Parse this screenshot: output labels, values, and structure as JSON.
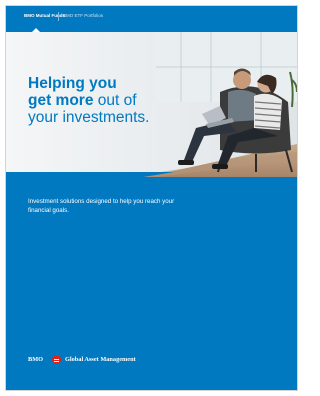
{
  "nav": {
    "tab_primary": "BMO Mutual Funds",
    "tab_secondary": "BMO ETF Portfolios"
  },
  "hero": {
    "headline_line1": "Helping you",
    "headline_line2_bold": "get more",
    "headline_line2_rest": " out of",
    "headline_line3": "your investments."
  },
  "body": {
    "tagline": "Investment solutions designed to help you reach your financial goals."
  },
  "brand": {
    "bmo": "BMO",
    "logo_icon": "bmo-roundel-icon",
    "division": "Global Asset Management"
  },
  "colors": {
    "brand_blue": "#0079c1",
    "logo_red": "#e2231a"
  }
}
